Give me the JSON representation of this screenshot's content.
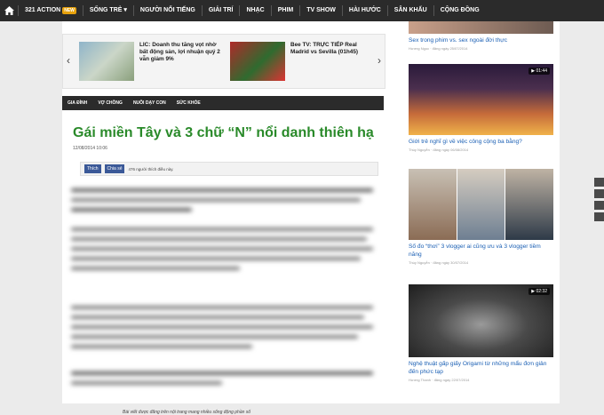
{
  "topnav": {
    "items": [
      {
        "label": "321 ACTION",
        "badge": "NEW"
      },
      {
        "label": "SỐNG TRẺ ▾"
      },
      {
        "label": "NGƯỜI NỔI TIẾNG"
      },
      {
        "label": "GIẢI TRÍ"
      },
      {
        "label": "NHẠC"
      },
      {
        "label": "PHIM"
      },
      {
        "label": "TV SHOW"
      },
      {
        "label": "HÀI HƯỚC"
      },
      {
        "label": "SÂN KHẤU"
      },
      {
        "label": "CỘNG ĐỒNG"
      }
    ]
  },
  "slider": {
    "item1": {
      "title": "LIC: Doanh thu tăng vọt nhờ bất động sản, lợi nhuận quý 2 vẫn giảm 9%"
    },
    "item2": {
      "title": "Bee TV: TRỰC TIẾP Real Madrid vs Sevilla (01h45)"
    }
  },
  "secnav": {
    "items": [
      "GIA ĐÌNH",
      "VỢ CHỒNG",
      "NUÔI DẠY CON",
      "SỨC KHỎE"
    ]
  },
  "article": {
    "title": "Gái miền Tây và 3 chữ “N” nổi danh thiên hạ",
    "date": "12/08/2014 10:06",
    "fb_like": "Thích",
    "fb_share": "Chia sẻ",
    "fb_count": "476 người thích điều này.",
    "caption": "Bài viết được đăng trên nội trang mang nhiều sống động phần số"
  },
  "right": {
    "top": {
      "title": "Sex trong phim vs. sex ngoài đời thực",
      "meta": "Hương Ngọc  ·  đăng ngày 25/07/2014"
    },
    "cards": [
      {
        "badge": "01:44",
        "title": "Giới trẻ nghĩ gì về việc công cộng ba bằng?",
        "meta": "Thúy Nguyễn  ·  đăng ngày 06/08/2014"
      },
      {
        "badge": "",
        "title": "Số đo “thơi” 3 vlogger ai cũng ưu và 3 vlogger tiềm năng",
        "meta": "Thúy Nguyễn  ·  đăng ngày 30/07/2014"
      },
      {
        "badge": "02:32",
        "title": "Nghệ thuật gấp giấy Origami từ những mẩu đơn giản đến phức tạp",
        "meta": "Hương Thanh  ·  đăng ngày 22/07/2014"
      }
    ]
  },
  "colors": {
    "accent_green": "#2a8a2a",
    "link_blue": "#1a5fb4",
    "nav_dark": "#2b2b2b",
    "tag_orange": "#e45c1e"
  }
}
